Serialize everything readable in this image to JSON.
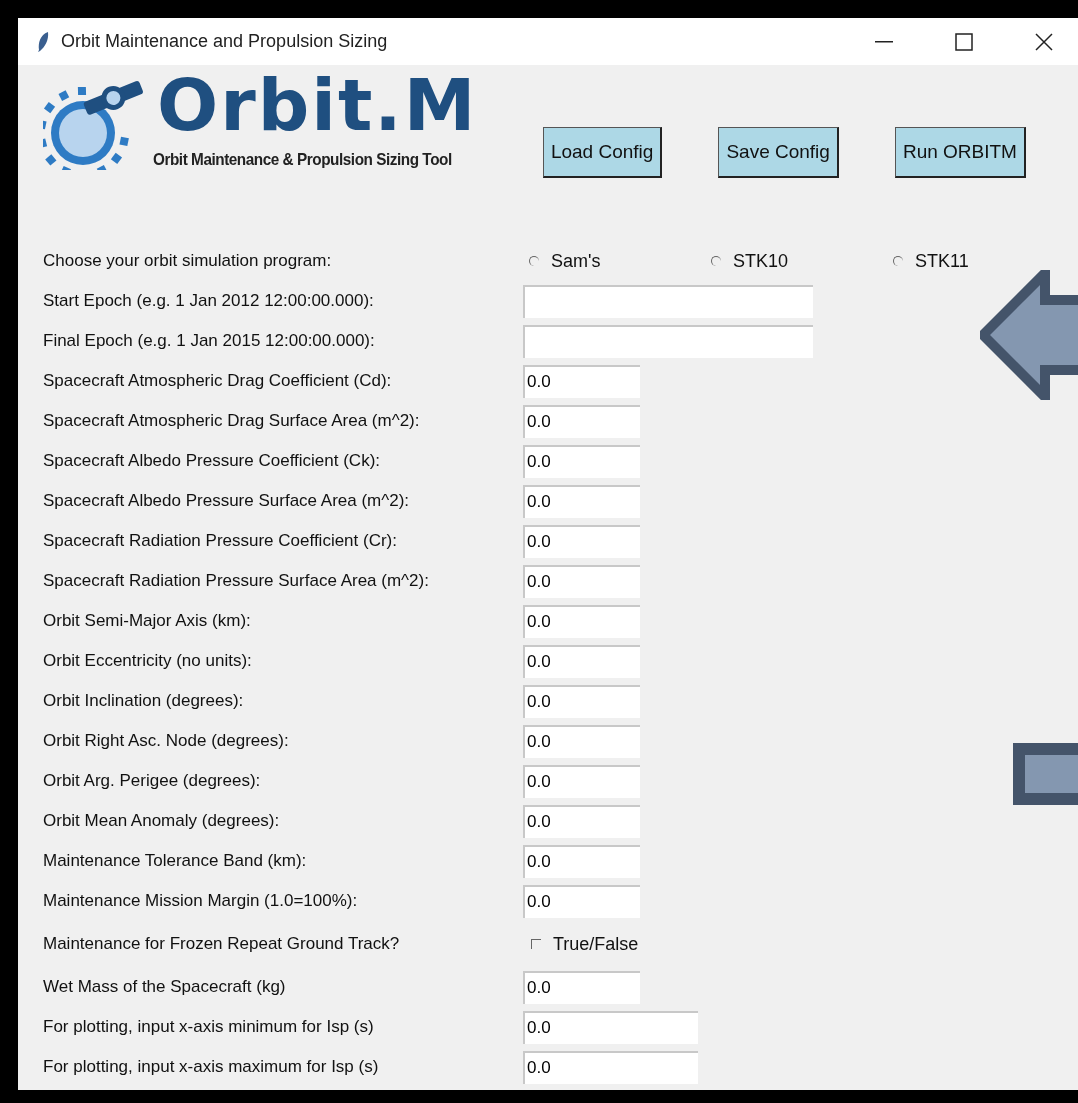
{
  "window": {
    "title": "Orbit Maintenance and Propulsion Sizing"
  },
  "logo": {
    "title": "Orbit.M",
    "subtitle": "Orbit Maintenance & Propulsion Sizing Tool"
  },
  "buttons": [
    "Load Config",
    "Save Config",
    "Run ORBITM"
  ],
  "form": [
    {
      "kind": "radio",
      "label": "Choose your orbit simulation program:",
      "options": [
        {
          "label": "Sam's",
          "selected": false
        },
        {
          "label": "STK10",
          "selected": false
        },
        {
          "label": "STK11",
          "selected": false
        }
      ]
    },
    {
      "kind": "text",
      "label": "Start Epoch (e.g. 1 Jan 2012 12:00:00.000):"
    },
    {
      "kind": "text",
      "label": "Final Epoch (e.g. 1 Jan 2015 12:00:00.000):"
    },
    {
      "kind": "text",
      "label": "Spacecraft Atmospheric Drag Coefficient (Cd):",
      "value": "0.0"
    },
    {
      "kind": "text",
      "label": "Spacecraft Atmospheric Drag Surface Area (m^2):",
      "value": "0.0"
    },
    {
      "kind": "text",
      "label": "Spacecraft Albedo Pressure Coefficient (Ck):",
      "value": "0.0"
    },
    {
      "kind": "text",
      "label": "Spacecraft Albedo Pressure Surface Area (m^2):",
      "value": "0.0"
    },
    {
      "kind": "text",
      "label": "Spacecraft Radiation Pressure Coefficient (Cr):",
      "value": "0.0"
    },
    {
      "kind": "text",
      "label": "Spacecraft Radiation Pressure Surface Area (m^2):",
      "value": "0.0"
    },
    {
      "kind": "text",
      "label": "Orbit Semi-Major Axis (km):",
      "value": "0.0"
    },
    {
      "kind": "text",
      "label": "Orbit Eccentricity (no units):",
      "value": "0.0"
    },
    {
      "kind": "text",
      "label": "Orbit Inclination (degrees):",
      "value": "0.0"
    },
    {
      "kind": "text",
      "label": "Orbit Right Asc. Node (degrees):",
      "value": "0.0"
    },
    {
      "kind": "text",
      "label": "Orbit Arg. Perigee (degrees):",
      "value": "0.0"
    },
    {
      "kind": "text",
      "label": "Orbit Mean Anomaly (degrees):",
      "value": "0.0"
    },
    {
      "kind": "text",
      "label": "Maintenance Tolerance Band (km):",
      "value": "0.0"
    },
    {
      "kind": "text",
      "label": "Maintenance Mission Margin (1.0=100%):",
      "value": "0.0"
    },
    {
      "kind": "checkbox",
      "label": "Maintenance for Frozen Repeat Ground Track?",
      "option": "True/False",
      "checked": false
    },
    {
      "kind": "text",
      "label": "Wet Mass of the Spacecraft (kg)",
      "value": "0.0"
    },
    {
      "kind": "text",
      "label": "For plotting, input x-axis minimum for Isp (s)",
      "value": "0.0"
    },
    {
      "kind": "text",
      "label": "For plotting, input x-axis maximum for Isp (s)",
      "value": "0.0"
    }
  ]
}
